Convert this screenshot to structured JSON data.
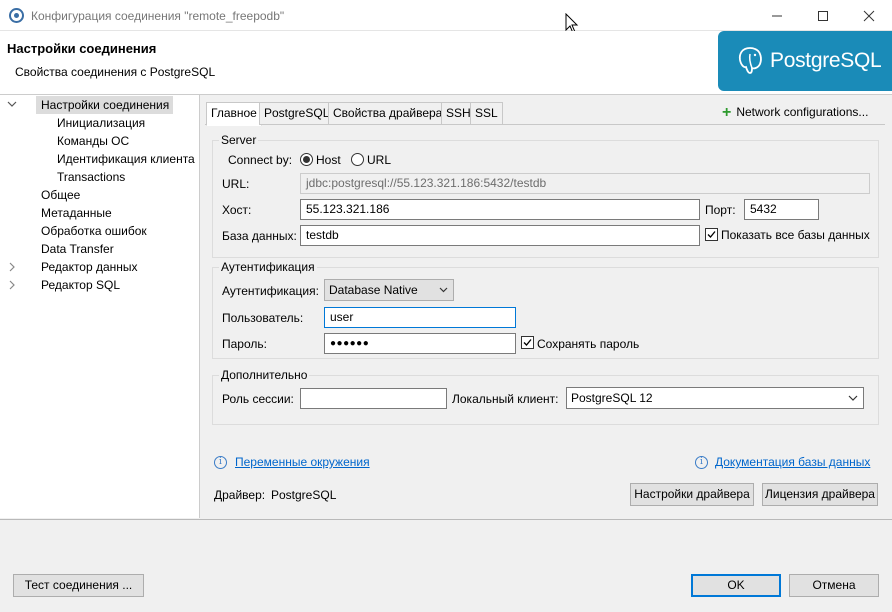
{
  "window": {
    "title": "Конфигурация соединения \"remote_freepodb\""
  },
  "header": {
    "title": "Настройки соединения",
    "subtitle": "Свойства соединения с PostgreSQL",
    "logo_text": "PostgreSQL",
    "logo_color": "#1a8bb8"
  },
  "tree": {
    "items": [
      {
        "label": "Настройки соединения",
        "level": 0,
        "expanded": true,
        "selected": true
      },
      {
        "label": "Инициализация",
        "level": 1
      },
      {
        "label": "Команды ОС",
        "level": 1
      },
      {
        "label": "Идентификация клиента",
        "level": 1
      },
      {
        "label": "Transactions",
        "level": 1
      },
      {
        "label": "Общее",
        "level": 0
      },
      {
        "label": "Метаданные",
        "level": 0
      },
      {
        "label": "Обработка ошибок",
        "level": 0
      },
      {
        "label": "Data Transfer",
        "level": 0
      },
      {
        "label": "Редактор данных",
        "level": 0,
        "collapsed": true
      },
      {
        "label": "Редактор SQL",
        "level": 0,
        "collapsed": true
      }
    ]
  },
  "tabs": [
    "Главное",
    "PostgreSQL",
    "Свойства драйвера",
    "SSH",
    "SSL"
  ],
  "network_configurations": "Network configurations...",
  "server": {
    "legend": "Server",
    "connect_by_label": "Connect by:",
    "host_option": "Host",
    "url_option": "URL",
    "url_label": "URL:",
    "url_value": "jdbc:postgresql://55.123.321.186:5432/testdb",
    "host_label": "Хост:",
    "host_value": "55.123.321.186",
    "port_label": "Порт:",
    "port_value": "5432",
    "db_label": "База данных:",
    "db_value": "testdb",
    "show_all_db": "Показать все базы данных"
  },
  "auth": {
    "legend": "Аутентификация",
    "auth_label": "Аутентификация:",
    "auth_value": "Database Native",
    "user_label": "Пользователь:",
    "user_value": "user",
    "password_label": "Пароль:",
    "password_value": "●●●●●●",
    "save_password": "Сохранять пароль"
  },
  "extra": {
    "legend": "Дополнительно",
    "role_label": "Роль сессии:",
    "role_value": "",
    "client_label": "Локальный клиент:",
    "client_value": "PostgreSQL 12"
  },
  "links": {
    "env_vars": "Переменные окружения",
    "db_docs": "Документация базы данных"
  },
  "driver": {
    "label": "Драйвер:",
    "value": "PostgreSQL",
    "settings_button": "Настройки драйвера",
    "license_button": "Лицензия драйвера"
  },
  "buttons": {
    "test_connection": "Тест соединения ...",
    "ok": "OK",
    "cancel": "Отмена"
  }
}
